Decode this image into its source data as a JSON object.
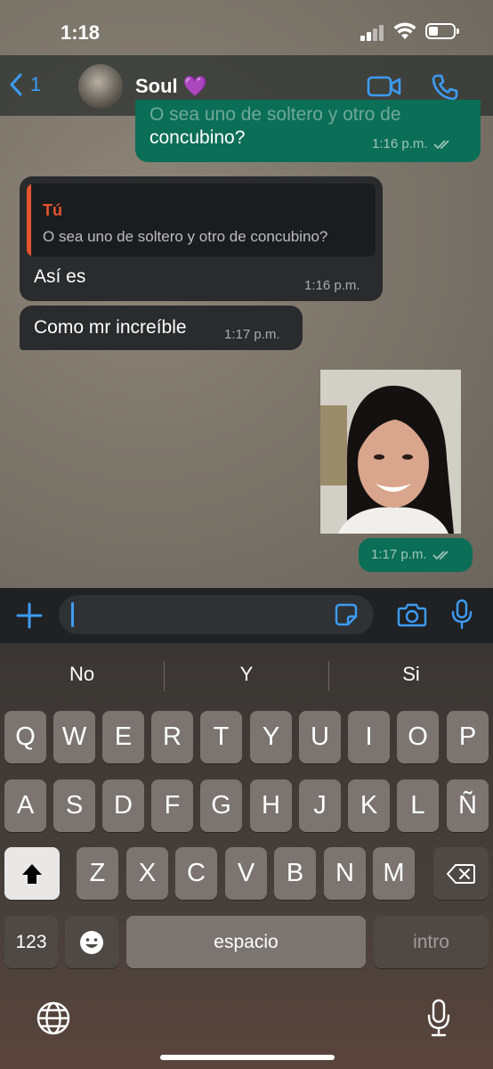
{
  "status_bar": {
    "time": "1:18"
  },
  "header": {
    "back_count": "1",
    "contact_name": "Soul 💜"
  },
  "messages": [
    {
      "direction": "out",
      "text_line1": "O sea uno de soltero y otro de",
      "text_line2": "concubino?",
      "time": "1:16 p.m."
    },
    {
      "direction": "in",
      "quote_author": "Tú",
      "quote_text": "O sea uno de soltero y otro de concubino?",
      "text": "Así es",
      "time": "1:16 p.m."
    },
    {
      "direction": "in",
      "text": "Como mr increíble",
      "time": "1:17 p.m."
    },
    {
      "direction": "out",
      "type": "image",
      "time": "1:17 p.m."
    }
  ],
  "keyboard": {
    "suggestions": [
      "No",
      "Y",
      "Si"
    ],
    "row1": [
      "Q",
      "W",
      "E",
      "R",
      "T",
      "Y",
      "U",
      "I",
      "O",
      "P"
    ],
    "row2": [
      "A",
      "S",
      "D",
      "F",
      "G",
      "H",
      "J",
      "K",
      "L",
      "Ñ"
    ],
    "row3": [
      "Z",
      "X",
      "C",
      "V",
      "B",
      "N",
      "M"
    ],
    "numbers_key": "123",
    "space_key": "espacio",
    "return_key": "intro"
  },
  "colors": {
    "accent": "#3d9cf5",
    "outgoing_bubble": "#0b6e56",
    "incoming_bubble": "#2a2b2d",
    "quote_author": "#e5532f"
  },
  "icons": [
    "back-chevron-icon",
    "video-call-icon",
    "phone-icon",
    "plus-icon",
    "sticker-icon",
    "camera-icon",
    "microphone-icon",
    "shift-icon",
    "backspace-icon",
    "emoji-icon",
    "globe-icon",
    "dictation-icon"
  ]
}
